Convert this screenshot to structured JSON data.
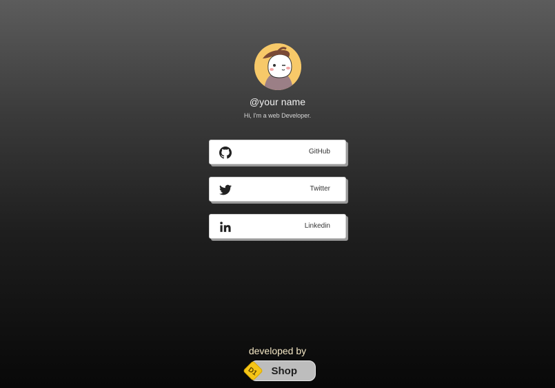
{
  "profile": {
    "username": "@your name",
    "tagline": "Hi, I'm a web Developer."
  },
  "links": [
    {
      "label": "GitHub",
      "icon": "github-icon"
    },
    {
      "label": "Twitter",
      "icon": "twitter-icon"
    },
    {
      "label": "Linkedin",
      "icon": "linkedin-icon"
    }
  ],
  "footer": {
    "developed_by": "developed by",
    "shop_label": "Shop",
    "logo_text": "D1",
    "logo_color": "#f5c518"
  },
  "colors": {
    "background_top": "#5c5c5c",
    "background_bottom": "#080808",
    "button_background": "#ffffff",
    "avatar_background": "#f7c969"
  }
}
